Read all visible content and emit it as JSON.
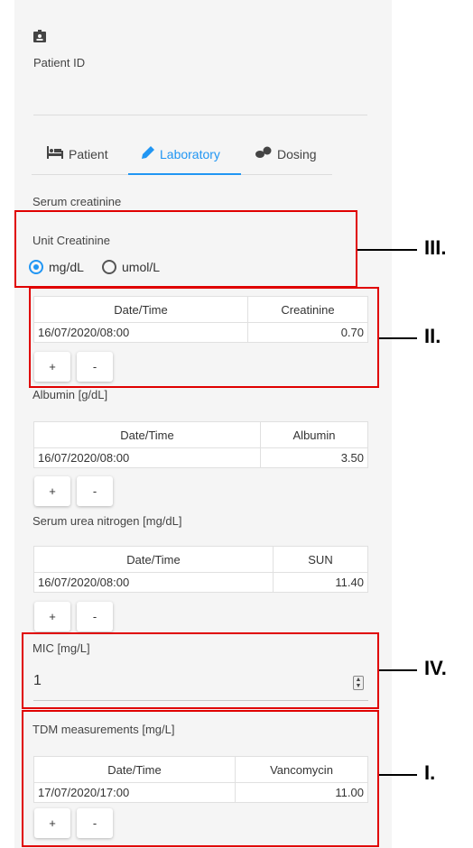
{
  "patient": {
    "icon": "badge-icon",
    "label": "Patient ID",
    "value": ""
  },
  "tabs": [
    {
      "label": "Patient",
      "icon": "bed-icon"
    },
    {
      "label": "Laboratory",
      "icon": "pen-icon",
      "active": true
    },
    {
      "label": "Dosing",
      "icon": "pills-icon"
    }
  ],
  "serum_creatinine": {
    "heading": "Serum creatinine",
    "unit_label": "Unit Creatinine",
    "options": [
      "mg/dL",
      "umol/L"
    ],
    "selected": "mg/dL",
    "table": {
      "headers": [
        "Date/Time",
        "Creatinine"
      ],
      "rows": [
        [
          "16/07/2020/08:00",
          "0.70"
        ]
      ]
    }
  },
  "albumin": {
    "heading": "Albumin [g/dL]",
    "table": {
      "headers": [
        "Date/Time",
        "Albumin"
      ],
      "rows": [
        [
          "16/07/2020/08:00",
          "3.50"
        ]
      ]
    }
  },
  "sun": {
    "heading": "Serum urea nitrogen [mg/dL]",
    "table": {
      "headers": [
        "Date/Time",
        "SUN"
      ],
      "rows": [
        [
          "16/07/2020/08:00",
          "11.40"
        ]
      ]
    }
  },
  "mic": {
    "label": "MIC [mg/L]",
    "value": "1"
  },
  "tdm": {
    "heading": "TDM measurements [mg/L]",
    "table": {
      "headers": [
        "Date/Time",
        "Vancomycin"
      ],
      "rows": [
        [
          "17/07/2020/17:00",
          "11.00"
        ]
      ]
    }
  },
  "buttons": {
    "add": "+",
    "remove": "-"
  },
  "annotations": [
    "III.",
    "II.",
    "IV.",
    "I."
  ],
  "colors": {
    "accent": "#2196f3",
    "annotation_box": "#e00000"
  }
}
